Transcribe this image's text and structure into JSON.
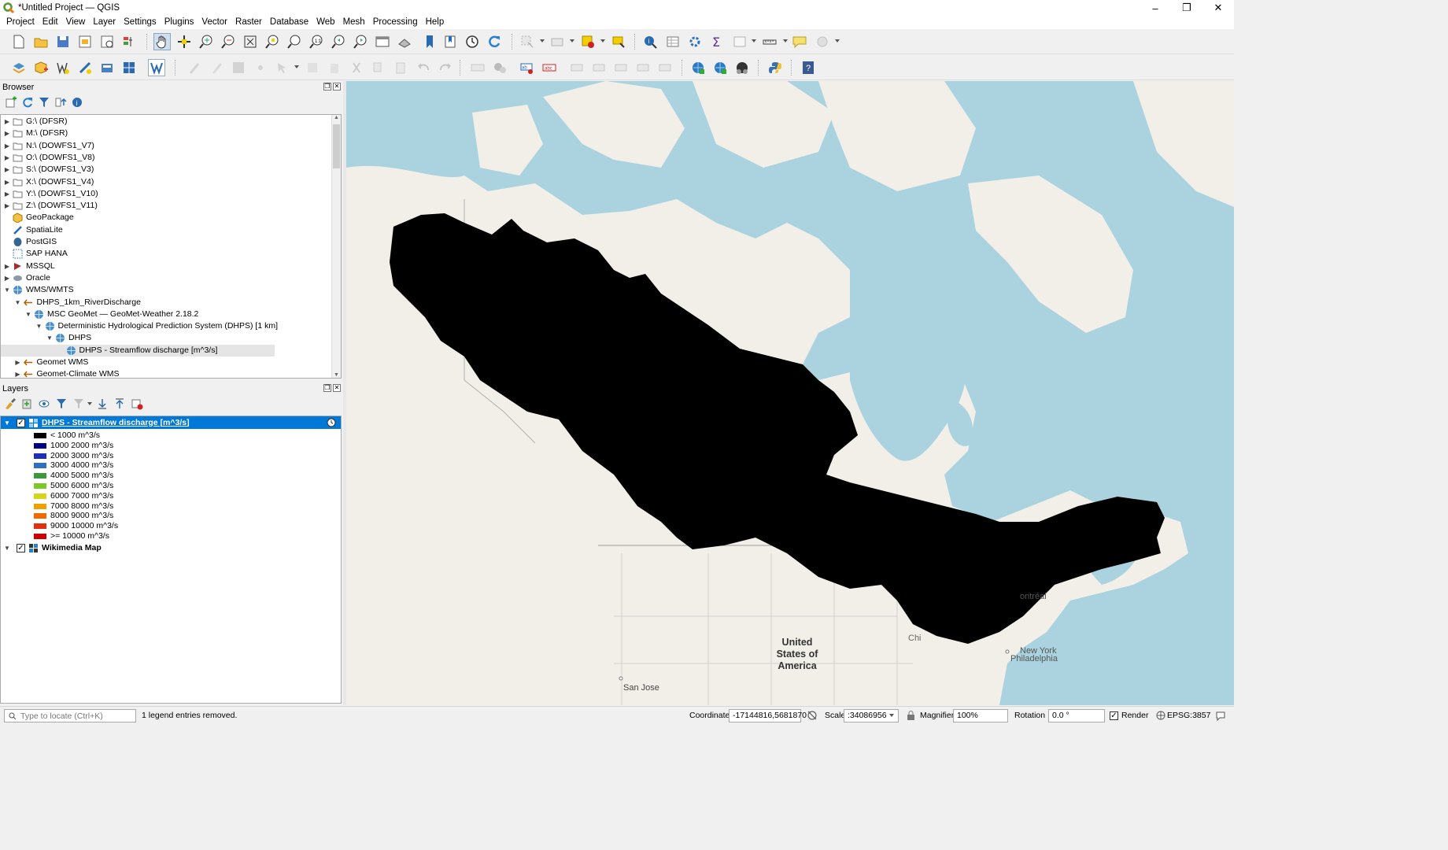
{
  "window": {
    "title": "*Untitled Project — QGIS",
    "minimize": "–",
    "maximize": "❐",
    "close": "✕"
  },
  "menu": [
    "Project",
    "Edit",
    "View",
    "Layer",
    "Settings",
    "Plugins",
    "Vector",
    "Raster",
    "Database",
    "Web",
    "Mesh",
    "Processing",
    "Help"
  ],
  "browser": {
    "title": "Browser",
    "items": [
      {
        "label": "G:\\ (DFSR)",
        "indent": 0,
        "arrow": "▶",
        "icon": "folder"
      },
      {
        "label": "M:\\ (DFSR)",
        "indent": 0,
        "arrow": "▶",
        "icon": "folder"
      },
      {
        "label": "N:\\ (DOWFS1_V7)",
        "indent": 0,
        "arrow": "▶",
        "icon": "folder"
      },
      {
        "label": "O:\\ (DOWFS1_V8)",
        "indent": 0,
        "arrow": "▶",
        "icon": "folder"
      },
      {
        "label": "S:\\ (DOWFS1_V3)",
        "indent": 0,
        "arrow": "▶",
        "icon": "folder"
      },
      {
        "label": "X:\\ (DOWFS1_V4)",
        "indent": 0,
        "arrow": "▶",
        "icon": "folder"
      },
      {
        "label": "Y:\\ (DOWFS1_V10)",
        "indent": 0,
        "arrow": "▶",
        "icon": "folder"
      },
      {
        "label": "Z:\\ (DOWFS1_V11)",
        "indent": 0,
        "arrow": "▶",
        "icon": "folder"
      },
      {
        "label": "GeoPackage",
        "indent": 0,
        "arrow": "",
        "icon": "geopackage"
      },
      {
        "label": "SpatiaLite",
        "indent": 0,
        "arrow": "",
        "icon": "spatialite"
      },
      {
        "label": "PostGIS",
        "indent": 0,
        "arrow": "",
        "icon": "postgis"
      },
      {
        "label": "SAP HANA",
        "indent": 0,
        "arrow": "",
        "icon": "hana"
      },
      {
        "label": "MSSQL",
        "indent": 0,
        "arrow": "▶",
        "icon": "mssql"
      },
      {
        "label": "Oracle",
        "indent": 0,
        "arrow": "▶",
        "icon": "oracle"
      },
      {
        "label": "WMS/WMTS",
        "indent": 0,
        "arrow": "▼",
        "icon": "globe"
      },
      {
        "label": "DHPS_1km_RiverDischarge",
        "indent": 1,
        "arrow": "▼",
        "icon": "connection"
      },
      {
        "label": "MSC GeoMet — GeoMet-Weather 2.18.2",
        "indent": 2,
        "arrow": "▼",
        "icon": "globe"
      },
      {
        "label": "Deterministic Hydrological Prediction System (DHPS) [1 km]",
        "indent": 3,
        "arrow": "▼",
        "icon": "globe"
      },
      {
        "label": "DHPS",
        "indent": 4,
        "arrow": "▼",
        "icon": "globe"
      },
      {
        "label": "DHPS - Streamflow discharge [m^3/s]",
        "indent": 5,
        "arrow": "",
        "icon": "globe",
        "selected": true
      },
      {
        "label": "Geomet WMS",
        "indent": 1,
        "arrow": "▶",
        "icon": "connection"
      },
      {
        "label": "Geomet-Climate WMS",
        "indent": 1,
        "arrow": "▶",
        "icon": "connection"
      }
    ]
  },
  "layers": {
    "title": "Layers",
    "active_layer": "DHPS - Streamflow discharge [m^3/s]",
    "legend": [
      {
        "label": "< 1000 m^3/s",
        "color": "#000000"
      },
      {
        "label": "1000 2000 m^3/s",
        "color": "#000080"
      },
      {
        "label": "2000 3000 m^3/s",
        "color": "#1c2fb8"
      },
      {
        "label": "3000 4000 m^3/s",
        "color": "#2e6fc0"
      },
      {
        "label": "4000 5000 m^3/s",
        "color": "#3c9a3c"
      },
      {
        "label": "5000 6000 m^3/s",
        "color": "#7cc829"
      },
      {
        "label": "6000 7000 m^3/s",
        "color": "#d6d617"
      },
      {
        "label": "7000 8000 m^3/s",
        "color": "#f0a000"
      },
      {
        "label": "8000 9000 m^3/s",
        "color": "#f06a00"
      },
      {
        "label": "9000 10000 m^3/s",
        "color": "#e03010"
      },
      {
        "label": ">= 10000 m^3/s",
        "color": "#d00000"
      }
    ],
    "base_layer": "Wikimedia Map"
  },
  "map": {
    "labels": {
      "us": "United",
      "us2": "States of",
      "us3": "America",
      "sanjose": "San Jose",
      "newyork": "New York",
      "philly": "Philadelphia",
      "montreal": "ontréal",
      "chi": "Chi"
    }
  },
  "status": {
    "locate_placeholder": "Type to locate (Ctrl+K)",
    "message": "1 legend entries removed.",
    "coordinate_label": "Coordinate",
    "coordinate": "-17144816,5681870",
    "scale_label": "Scale",
    "scale": ":34086956",
    "magnifier_label": "Magnifier",
    "magnifier": "100%",
    "rotation_label": "Rotation",
    "rotation": "0.0 °",
    "render_label": "Render",
    "crs": "EPSG:3857"
  },
  "colors": {
    "selection": "#0078d7",
    "water": "#aad3df",
    "land": "#f2efe9"
  }
}
